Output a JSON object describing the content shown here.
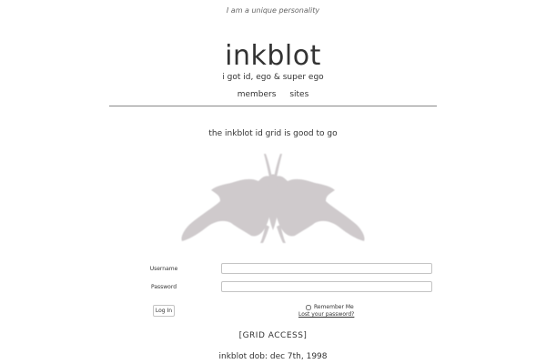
{
  "header": {
    "tagline": "I am a unique personality",
    "title": "inkblot",
    "subtitle": "i got id, ego & super ego"
  },
  "nav": {
    "items": [
      {
        "label": "members"
      },
      {
        "label": "sites"
      }
    ]
  },
  "main": {
    "status_message": "the inkblot id grid is good to go",
    "inkblot_color": "#cfcacc"
  },
  "login": {
    "username_label": "Username",
    "password_label": "Password",
    "username_value": "",
    "password_value": "",
    "remember_label": "Remember Me",
    "remember_checked": false,
    "lost_password": "Lost your password?",
    "login_button": "Log In"
  },
  "footer": {
    "grid_access": "[GRID ACCESS]",
    "dob": "inkblot dob: dec 7th, 1998"
  }
}
